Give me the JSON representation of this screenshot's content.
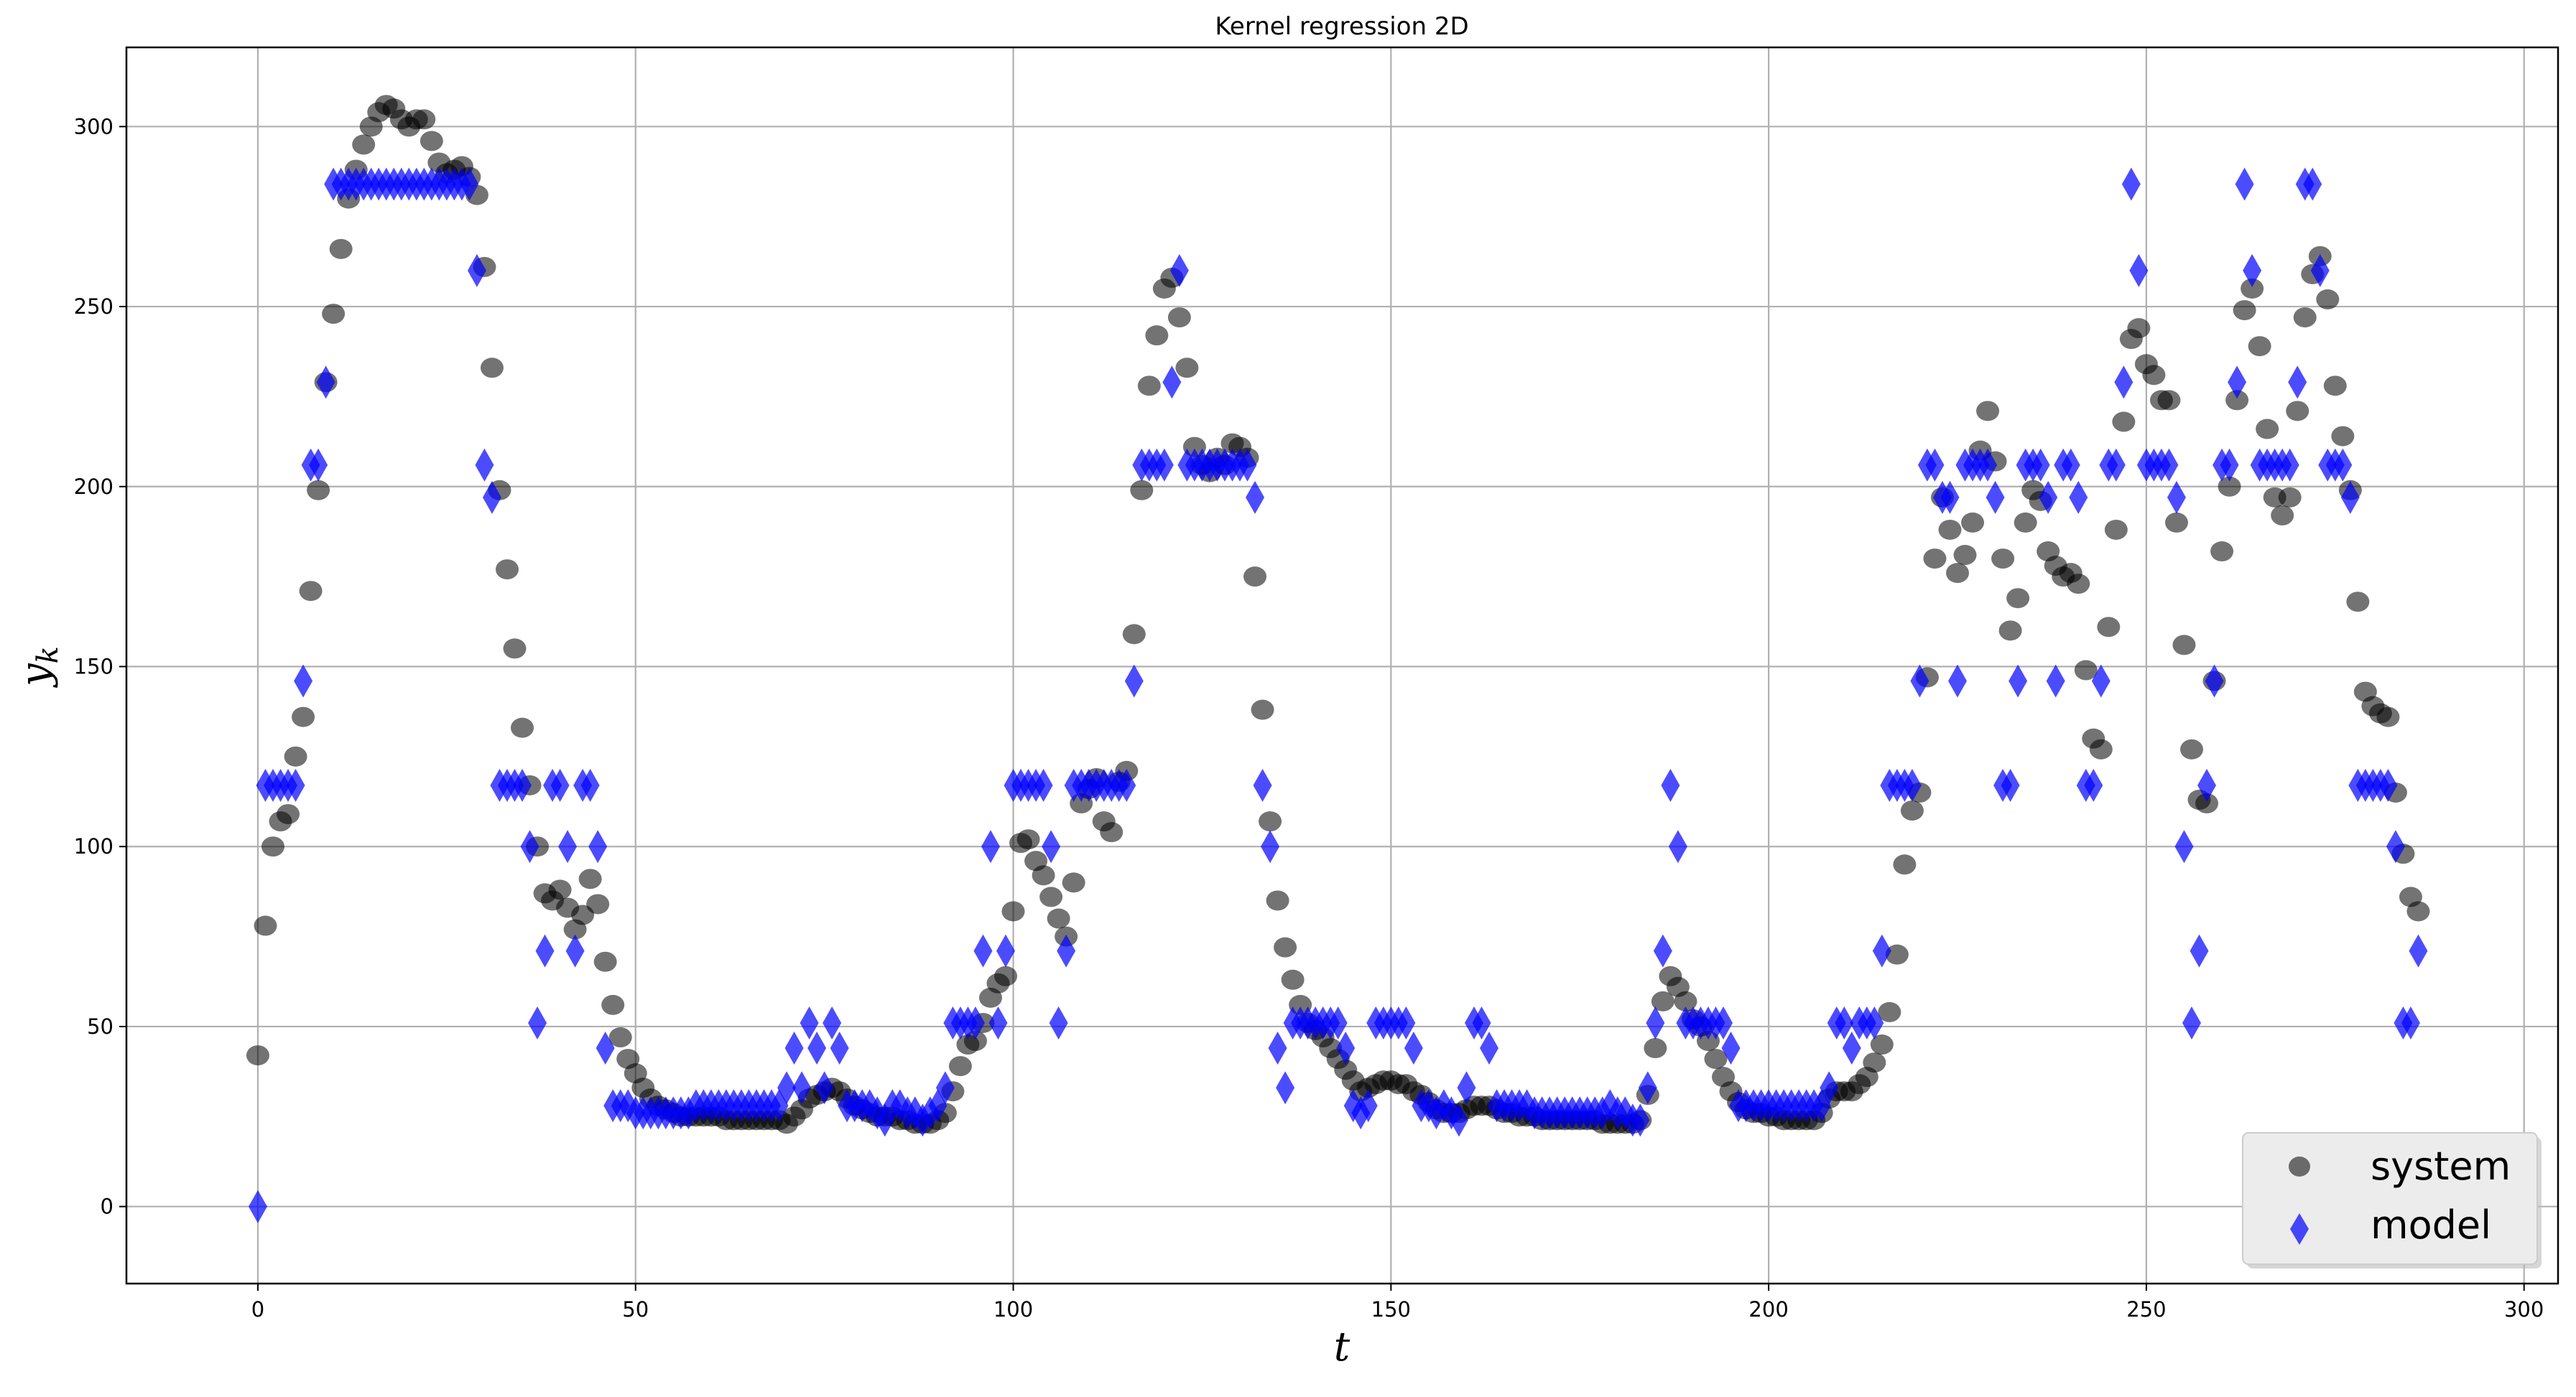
{
  "chart_data": {
    "type": "scatter",
    "title": "Kernel regression 2D",
    "xlabel": "t",
    "ylabel": "y_k",
    "xlim": [
      -17.4,
      304.5
    ],
    "ylim": [
      -21.4,
      322
    ],
    "xticks": [
      0,
      50,
      100,
      150,
      200,
      250,
      300
    ],
    "yticks": [
      0,
      50,
      100,
      150,
      200,
      250,
      300
    ],
    "grid": true,
    "legend_position": "bottom-right",
    "series": [
      {
        "name": "system",
        "marker": "circle",
        "color": "#000000",
        "alpha": 0.55,
        "values": [
          42,
          78,
          100,
          107,
          109,
          125,
          136,
          171,
          199,
          229,
          248,
          266,
          280,
          288,
          295,
          300,
          304,
          306,
          305,
          302,
          300,
          302,
          302,
          296,
          290,
          287,
          288,
          289,
          286,
          281,
          261,
          233,
          199,
          177,
          155,
          133,
          117,
          100,
          87,
          85,
          88,
          83,
          77,
          81,
          91,
          84,
          68,
          56,
          47,
          41,
          37,
          33,
          30,
          28,
          27,
          26,
          25,
          25,
          25,
          25,
          25,
          25,
          24,
          24,
          24,
          24,
          24,
          24,
          24,
          24,
          23,
          25,
          27,
          30,
          31,
          32,
          33,
          32,
          30,
          28,
          27,
          26,
          25,
          25,
          25,
          24,
          24,
          23,
          23,
          23,
          24,
          26,
          32,
          39,
          45,
          46,
          51,
          58,
          62,
          64,
          82,
          101,
          102,
          96,
          92,
          86,
          80,
          75,
          90,
          112,
          116,
          119,
          107,
          104,
          118,
          121,
          159,
          199,
          228,
          242,
          255,
          258,
          247,
          233,
          211,
          206,
          204,
          208,
          206,
          212,
          211,
          208,
          175,
          138,
          107,
          85,
          72,
          63,
          56,
          51,
          49,
          47,
          44,
          41,
          38,
          35,
          32,
          33,
          34,
          35,
          35,
          34,
          34,
          32,
          31,
          29,
          27,
          26,
          26,
          26,
          27,
          28,
          28,
          28,
          27,
          26,
          26,
          25,
          25,
          25,
          24,
          24,
          24,
          24,
          24,
          24,
          24,
          24,
          23,
          23,
          23,
          23,
          23,
          24,
          31,
          44,
          57,
          64,
          61,
          57,
          52,
          50,
          46,
          41,
          36,
          32,
          29,
          27,
          26,
          26,
          25,
          25,
          24,
          24,
          24,
          24,
          24,
          26,
          30,
          32,
          32,
          32,
          34,
          36,
          40,
          45,
          54,
          70,
          95,
          110,
          115,
          147,
          180,
          197,
          188,
          176,
          181,
          190,
          210,
          221,
          207,
          180,
          160,
          169,
          190,
          199,
          196,
          182,
          178,
          175,
          176,
          173,
          149,
          130,
          127,
          161,
          188,
          218,
          241,
          244,
          234,
          231,
          224,
          224,
          190,
          156,
          127,
          113,
          112,
          146,
          182,
          200,
          224,
          249,
          255,
          239,
          216,
          197,
          192,
          197,
          221,
          247,
          259,
          264,
          252,
          228,
          214,
          199,
          168,
          143,
          139,
          137,
          136,
          115,
          98,
          86,
          82
        ]
      },
      {
        "name": "model",
        "marker": "diamond",
        "color": "#0000ff",
        "alpha": 0.7,
        "values": [
          0,
          117,
          117,
          117,
          117,
          117,
          146,
          206,
          206,
          229,
          284,
          284,
          284,
          284,
          284,
          284,
          284,
          284,
          284,
          284,
          284,
          284,
          284,
          284,
          284,
          284,
          284,
          284,
          284,
          260,
          206,
          197,
          117,
          117,
          117,
          117,
          100,
          51,
          71,
          117,
          117,
          100,
          71,
          117,
          117,
          100,
          44,
          28,
          28,
          28,
          26,
          26,
          26,
          26,
          26,
          26,
          26,
          26,
          28,
          28,
          28,
          28,
          28,
          28,
          28,
          28,
          28,
          28,
          28,
          28,
          33,
          44,
          33,
          51,
          44,
          33,
          51,
          44,
          28,
          28,
          28,
          28,
          26,
          24,
          28,
          28,
          26,
          26,
          24,
          26,
          28,
          33,
          51,
          51,
          51,
          51,
          71,
          100,
          51,
          71,
          117,
          117,
          117,
          117,
          117,
          100,
          51,
          71,
          117,
          117,
          117,
          117,
          117,
          117,
          117,
          117,
          146,
          206,
          206,
          206,
          206,
          229,
          260,
          206,
          206,
          206,
          206,
          206,
          206,
          206,
          206,
          206,
          197,
          117,
          100,
          44,
          33,
          51,
          51,
          51,
          51,
          51,
          51,
          51,
          44,
          28,
          26,
          28,
          51,
          51,
          51,
          51,
          51,
          44,
          28,
          28,
          26,
          28,
          26,
          24,
          33,
          51,
          51,
          44,
          28,
          28,
          28,
          28,
          28,
          26,
          26,
          26,
          26,
          26,
          26,
          26,
          26,
          26,
          26,
          28,
          26,
          26,
          24,
          24,
          33,
          51,
          71,
          117,
          100,
          51,
          51,
          51,
          51,
          51,
          51,
          44,
          28,
          28,
          28,
          28,
          28,
          28,
          28,
          28,
          28,
          28,
          28,
          28,
          33,
          51,
          51,
          44,
          51,
          51,
          51,
          71,
          117,
          117,
          117,
          117,
          146,
          206,
          206,
          197,
          197,
          146,
          206,
          206,
          206,
          206,
          197,
          117,
          117,
          146,
          206,
          206,
          206,
          197,
          146,
          206,
          206,
          197,
          117,
          117,
          146,
          206,
          206,
          229,
          284,
          260,
          206,
          206,
          206,
          206,
          197,
          100,
          51,
          71,
          117,
          146,
          206,
          206,
          229,
          284,
          260,
          206,
          206,
          206,
          206,
          206,
          229,
          284,
          284,
          260,
          206,
          206,
          206,
          197,
          117,
          117,
          117,
          117,
          117,
          100,
          51,
          51,
          71
        ]
      }
    ]
  }
}
